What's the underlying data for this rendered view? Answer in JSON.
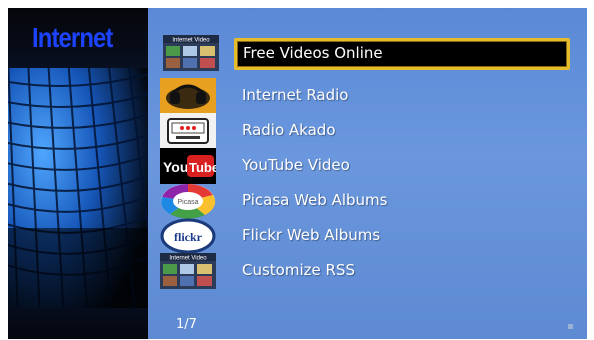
{
  "left_panel": {
    "title": "Internet"
  },
  "menu": {
    "items": [
      {
        "label": "Free Videos Online",
        "icon": "free-videos-icon",
        "selected": true,
        "thumb_text": "Internet Video"
      },
      {
        "label": "Internet Radio",
        "icon": "internet-radio-icon",
        "selected": false
      },
      {
        "label": "Radio Akado",
        "icon": "radio-akado-icon",
        "selected": false
      },
      {
        "label": "YouTube Video",
        "icon": "youtube-icon",
        "selected": false,
        "thumb_text_1": "You",
        "thumb_text_2": "Tube"
      },
      {
        "label": "Picasa Web Albums",
        "icon": "picasa-icon",
        "selected": false,
        "thumb_text": "Picasa"
      },
      {
        "label": "Flickr Web Albums",
        "icon": "flickr-icon",
        "selected": false,
        "thumb_text": "flickr"
      },
      {
        "label": "Customize RSS",
        "icon": "customize-rss-icon",
        "selected": false,
        "thumb_text": "Internet Video"
      }
    ]
  },
  "page_indicator": "1/7",
  "colors": {
    "accent": "#e6bb2c",
    "panel_blue": "#6a97dd",
    "title_blue": "#1c43ff"
  }
}
